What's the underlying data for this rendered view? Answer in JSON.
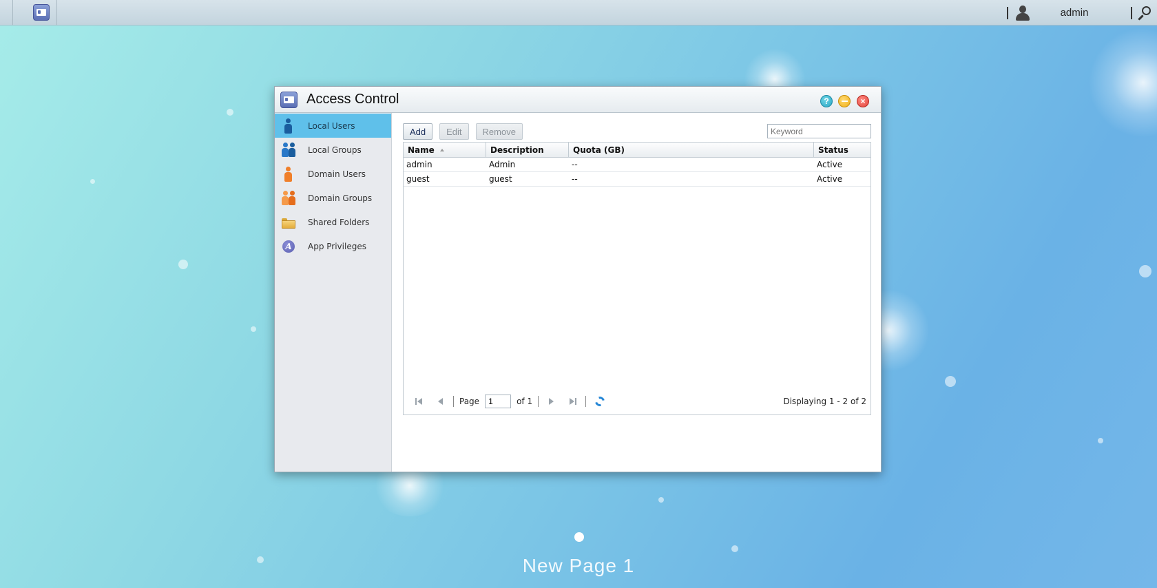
{
  "taskbar": {
    "user_name": "admin"
  },
  "window": {
    "title": "Access Control",
    "sidebar": [
      {
        "label": "Local Users",
        "icon": "local-user-icon",
        "active": true
      },
      {
        "label": "Local Groups",
        "icon": "local-group-icon"
      },
      {
        "label": "Domain Users",
        "icon": "domain-user-icon"
      },
      {
        "label": "Domain Groups",
        "icon": "domain-group-icon"
      },
      {
        "label": "Shared Folders",
        "icon": "folder-icon"
      },
      {
        "label": "App Privileges",
        "icon": "app-privileges-icon"
      }
    ],
    "toolbar": {
      "add": "Add",
      "edit": "Edit",
      "remove": "Remove"
    },
    "search": {
      "placeholder": "Keyword"
    },
    "table": {
      "columns": [
        "Name",
        "Description",
        "Quota (GB)",
        "Status"
      ],
      "rows": [
        [
          "admin",
          "Admin",
          "--",
          "Active"
        ],
        [
          "guest",
          "guest",
          "--",
          "Active"
        ]
      ]
    },
    "pager": {
      "page_label": "Page",
      "page_value": "1",
      "of_label": "of 1",
      "display": "Displaying 1 - 2 of 2"
    }
  },
  "desktop": {
    "page_name": "New Page 1"
  },
  "colors": {
    "active_nav": "#5fc0ea",
    "accent_blue": "#2486d6"
  }
}
